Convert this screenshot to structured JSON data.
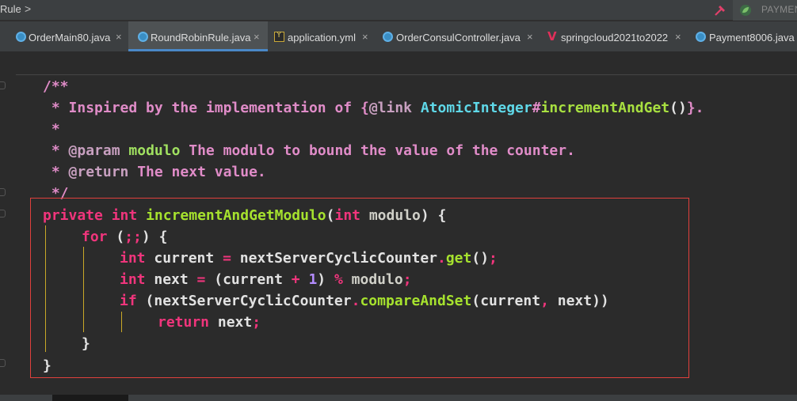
{
  "breadcrumb": {
    "label": "Rule",
    "chevron": ">"
  },
  "run_config": {
    "label": "PAYMEN",
    "icon": "spring-leaf-icon"
  },
  "tabs": [
    {
      "label": "OrderMain80.java",
      "icon": "class-icon",
      "close": "×",
      "active": false
    },
    {
      "label": "RoundRobinRule.java",
      "icon": "class-icon",
      "close": "×",
      "active": true
    },
    {
      "label": "application.yml",
      "icon": "yaml-icon",
      "icon_text": "Y",
      "close": "×",
      "active": false
    },
    {
      "label": "OrderConsulController.java",
      "icon": "class-icon",
      "close": "×",
      "active": false
    },
    {
      "label": "springcloud2021to2022",
      "icon": "vue-icon",
      "icon_text": "V",
      "close": "×",
      "active": false
    },
    {
      "label": "Payment8006.java",
      "icon": "class-icon",
      "active": false
    }
  ],
  "code": {
    "l1": "/**",
    "l2_star": " * ",
    "l2_a": "Inspired by the implementation of {",
    "l2_tag": "@link",
    "l2_sp": " ",
    "l2_cls": "AtomicInteger",
    "l2_hash": "#",
    "l2_meth": "incrementAndGet",
    "l2_par": "()",
    "l2_end": "}.",
    "l3": " *",
    "l4_star": " * ",
    "l4_tag": "@param",
    "l4_sp": " ",
    "l4_name": "modulo",
    "l4_desc": " The modulo to bound the value of the counter.",
    "l5_star": " * ",
    "l5_tag": "@return",
    "l5_desc": " The next value.",
    "l6": " */",
    "l7_kw1": "private",
    "l7_sp1": " ",
    "l7_kw2": "int",
    "l7_sp2": " ",
    "l7_fn": "incrementAndGetModulo",
    "l7_p1": "(",
    "l7_kw3": "int",
    "l7_sp3": " ",
    "l7_param": "modulo",
    "l7_p2": ") {",
    "l8_kw": "for",
    "l8_a": " (",
    "l8_semi": ";;",
    "l8_b": ") {",
    "l9_kw": "int",
    "l9_a": " current ",
    "l9_eq": "=",
    "l9_b": " nextServerCyclicCounter",
    "l9_dot": ".",
    "l9_fn": "get",
    "l9_c": "()",
    "l9_semi": ";",
    "l10_kw": "int",
    "l10_a": " next ",
    "l10_eq": "=",
    "l10_b": " (current ",
    "l10_plus": "+",
    "l10_sp": " ",
    "l10_num": "1",
    "l10_c": ") ",
    "l10_mod": "%",
    "l10_d": " modulo",
    "l10_semi": ";",
    "l11_kw": "if",
    "l11_a": " (nextServerCyclicCounter",
    "l11_dot": ".",
    "l11_fn": "compareAndSet",
    "l11_b": "(current",
    "l11_comma": ",",
    "l11_c": " next))",
    "l12_kw": "return",
    "l12_a": " next",
    "l12_semi": ";",
    "l13": "}",
    "l14": "}"
  }
}
